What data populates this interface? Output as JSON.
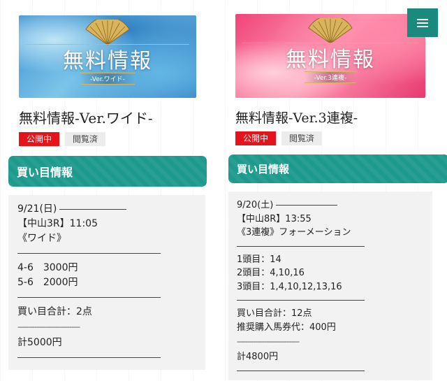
{
  "left": {
    "banner": {
      "title": "無料情報",
      "subtitle": "-Ver.ワイド-"
    },
    "post_title": "無料情報-Ver.ワイド-",
    "badge_open": "公開中",
    "badge_viewed": "閲覧済",
    "section_bar": "買い目情報",
    "card": {
      "date": "9/21(日)",
      "race": "【中山3R】11:05",
      "bet_type": "《ワイド》",
      "bets": [
        "4-6　3000円",
        "5-6　2000円"
      ],
      "total_points": "買い目合計：2点",
      "dashes": "------------------------------",
      "total_amount": "計5000円"
    }
  },
  "right": {
    "banner": {
      "title": "無料情報",
      "subtitle": "-Ver.3連複-"
    },
    "post_title": "無料情報-Ver.3連複-",
    "badge_open": "公開中",
    "badge_viewed": "閲覧済",
    "section_bar": "買い目情報",
    "card": {
      "date": "9/20(土)",
      "race": "【中山8R】13:55",
      "bet_type": "《3連複》フォーメーション",
      "legs": [
        "1頭目：14",
        "2頭目：4,10,16",
        "3頭目：1,4,10,12,13,16"
      ],
      "total_points": "買い目合計：12点",
      "recommended": "推奨購入馬券代：400円",
      "dashes": "------------------------------",
      "total_amount": "計4800円"
    }
  },
  "menu": {
    "icon": "hamburger-menu-icon"
  },
  "colors": {
    "teal": "#1e9a8d",
    "badge_red": "#e4141e",
    "card_bg": "#f2f2f2"
  }
}
